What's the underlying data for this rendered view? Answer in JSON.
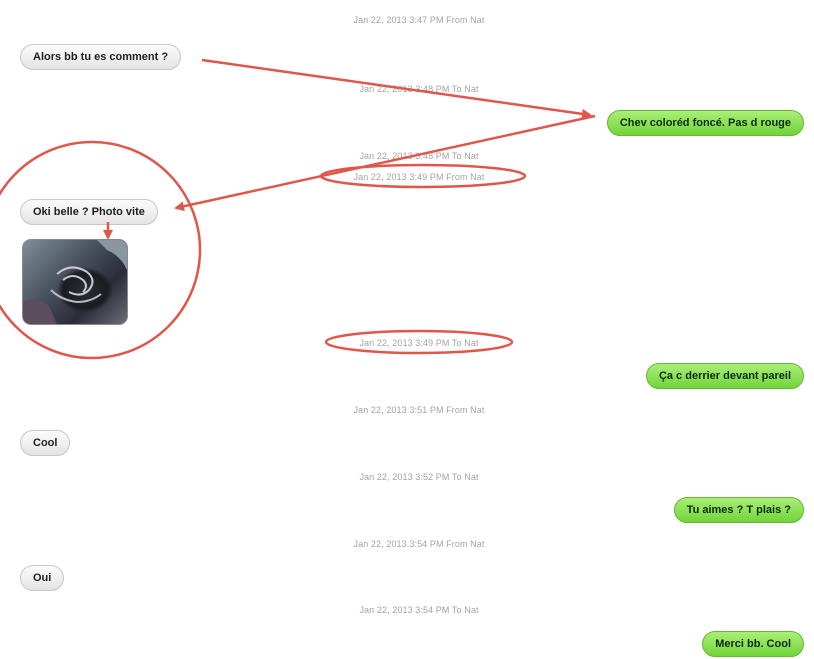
{
  "thread": [
    {
      "kind": "timestamp",
      "text": "Jan 22, 2013 3:47 PM From Nat"
    },
    {
      "kind": "incoming",
      "text": "Alors bb tu es comment ?"
    },
    {
      "kind": "timestamp",
      "text": "Jan 22, 2013 3:48 PM To Nat"
    },
    {
      "kind": "outgoing",
      "text": "Chev coloréd foncé. Pas d rouge"
    },
    {
      "kind": "timestamp",
      "text": "Jan 22, 2013 3:48 PM To Nat"
    },
    {
      "kind": "timestamp",
      "text": "Jan 22, 2013 3:49 PM From Nat"
    },
    {
      "kind": "incoming",
      "text": "Oki belle ? Photo vite"
    },
    {
      "kind": "incoming-image"
    },
    {
      "kind": "timestamp",
      "text": "Jan 22, 2013 3:49 PM To Nat"
    },
    {
      "kind": "outgoing",
      "text": "Ça c derrier devant pareil"
    },
    {
      "kind": "timestamp",
      "text": "Jan 22, 2013 3:51 PM From Nat"
    },
    {
      "kind": "incoming",
      "text": "Cool"
    },
    {
      "kind": "timestamp",
      "text": "Jan 22, 2013 3:52 PM To Nat"
    },
    {
      "kind": "outgoing",
      "text": "Tu aimes ? T plais ?"
    },
    {
      "kind": "timestamp",
      "text": "Jan 22, 2013 3:54 PM From Nat"
    },
    {
      "kind": "incoming",
      "text": "Oui"
    },
    {
      "kind": "timestamp",
      "text": "Jan 22, 2013 3:54 PM To Nat"
    },
    {
      "kind": "outgoing",
      "text": "Merci bb. Cool"
    }
  ],
  "annotation_color": "#e0574a",
  "colors": {
    "outgoing_bubble": "#8ee25a",
    "incoming_bubble": "#eeeeee",
    "timestamp_text": "#a3a3a3"
  }
}
